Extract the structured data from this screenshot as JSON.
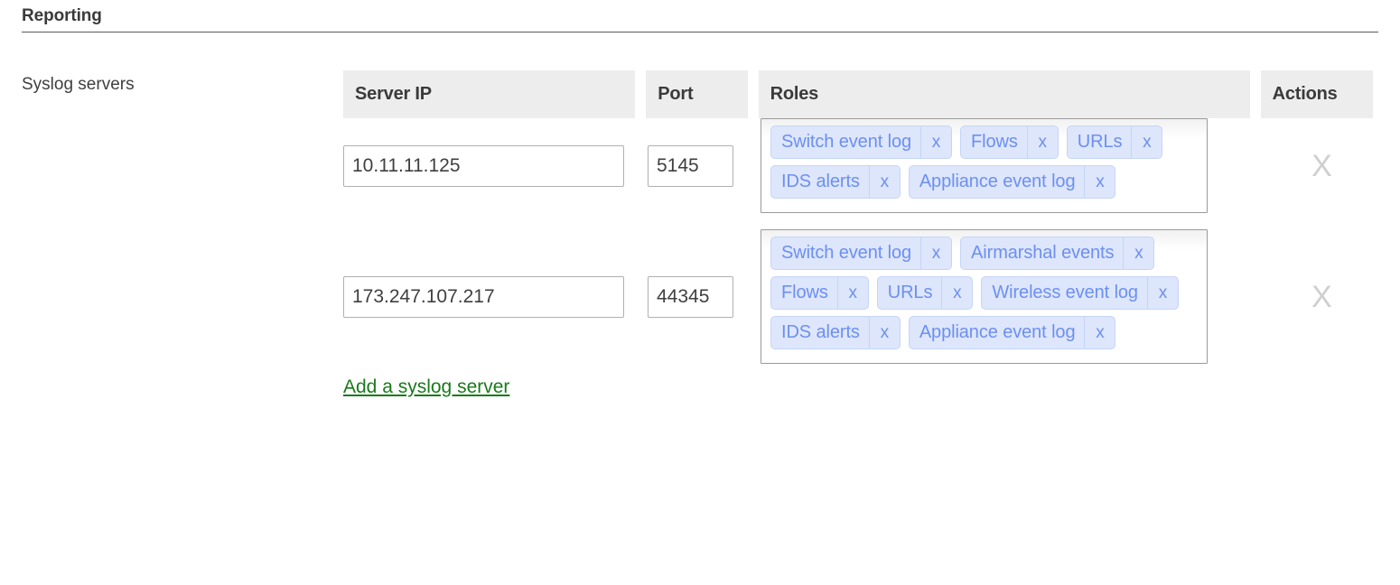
{
  "section": {
    "title": "Reporting"
  },
  "field": {
    "label": "Syslog servers"
  },
  "table": {
    "headers": {
      "server_ip": "Server IP",
      "port": "Port",
      "roles": "Roles",
      "actions": "Actions"
    },
    "rows": [
      {
        "server_ip": "10.11.11.125",
        "port": "5145",
        "roles": [
          "Switch event log",
          "Flows",
          "URLs",
          "IDS alerts",
          "Appliance event log"
        ],
        "remove_label": "X",
        "tag_remove_label": "x"
      },
      {
        "server_ip": "173.247.107.217",
        "port": "44345",
        "roles": [
          "Switch event log",
          "Airmarshal events",
          "Flows",
          "URLs",
          "Wireless event log",
          "IDS alerts",
          "Appliance event log"
        ],
        "remove_label": "X",
        "tag_remove_label": "x"
      }
    ]
  },
  "actions": {
    "add_link": "Add a syslog server"
  },
  "colors": {
    "tag_background": "#dde6fb",
    "tag_border": "#c5d5f8",
    "tag_text": "#6d8ff2",
    "header_background": "#ededed",
    "link_green": "#1a7a1a",
    "delete_icon": "#cfcfcf",
    "heading_text": "#3a3a3a",
    "input_border": "#b0b0b0",
    "roles_box_border": "#9b9b9b"
  }
}
